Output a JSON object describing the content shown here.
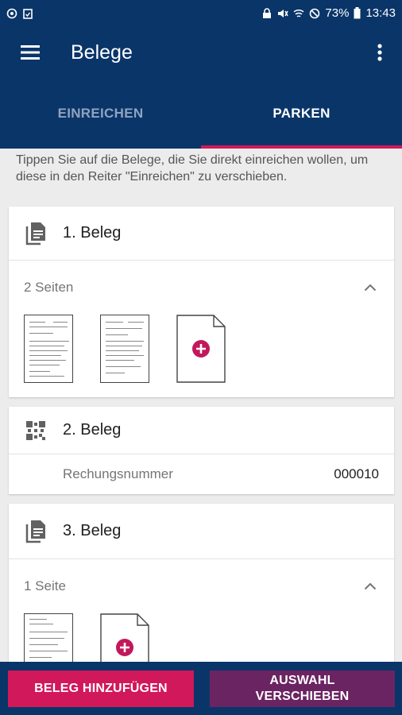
{
  "status_bar": {
    "battery": "73%",
    "time": "13:43",
    "icons_left": [
      "vpn-icon",
      "clipboard-icon"
    ],
    "icons_right": [
      "lock-icon",
      "mute-icon",
      "wifi-icon",
      "dnd-icon",
      "battery-icon"
    ]
  },
  "app_bar": {
    "title": "Belege",
    "menu_icon": "hamburger-icon",
    "more_icon": "more-vert-icon"
  },
  "tabs": [
    {
      "label": "EINREICHEN",
      "active": false
    },
    {
      "label": "PARKEN",
      "active": true
    }
  ],
  "hint": "Tippen Sie auf die Belege, die Sie direkt einreichen wollen, um diese in den Reiter \"Einreichen\" zu verschieben.",
  "belege": [
    {
      "title": "1. Beleg",
      "icon": "document-icon",
      "pages_label": "2 Seiten"
    },
    {
      "title": "2. Beleg",
      "icon": "qr-code-icon",
      "field_label": "Rechungsnummer",
      "field_value": "000010"
    },
    {
      "title": "3. Beleg",
      "icon": "document-icon",
      "pages_label": "1 Seite"
    }
  ],
  "buttons": {
    "add": "BELEG HINZUFÜGEN",
    "move": "AUSWAHL VERSCHIEBEN"
  },
  "colors": {
    "primary_dark": "#0a3569",
    "accent": "#d1185a",
    "secondary": "#6b2462"
  }
}
